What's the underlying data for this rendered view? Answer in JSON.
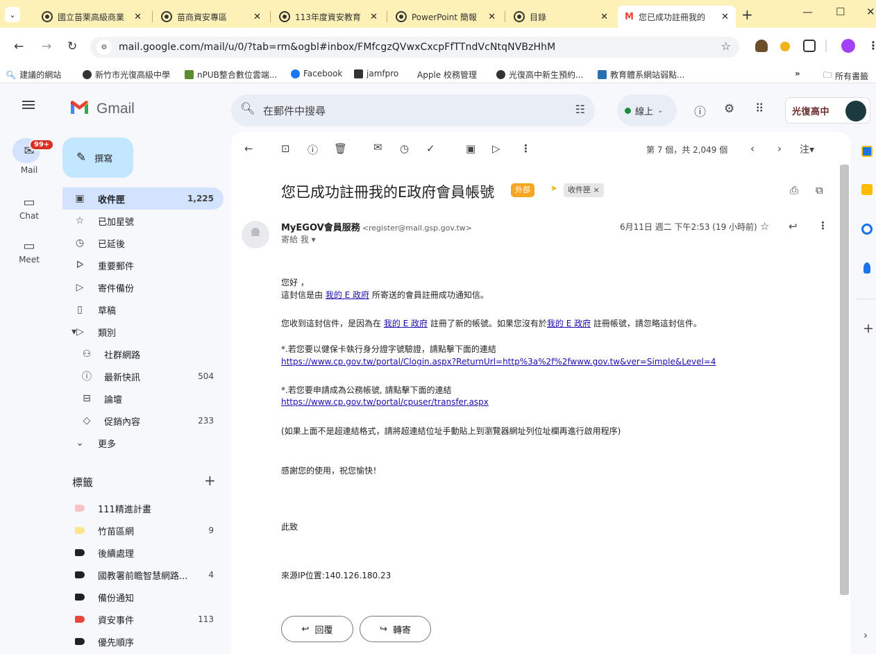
{
  "browser": {
    "tabs": [
      {
        "title": "國立苗栗高級商業"
      },
      {
        "title": "苗商資安專區"
      },
      {
        "title": "113年度資安教育"
      },
      {
        "title": "PowerPoint 簡報"
      },
      {
        "title": "目錄"
      },
      {
        "title": "您已成功註冊我的"
      }
    ],
    "url": "mail.google.com/mail/u/0/?tab=rm&ogbl#inbox/FMfcgzQVwxCxcpFfTTndVcNtqNVBzHhM",
    "bookmarks": [
      "建議的網站",
      "新竹市光復高級中學",
      "nPUB整合數位雲端...",
      "Facebook",
      "jamfpro",
      "Apple 校務管理",
      "光復高中新生預約...",
      "教育體系網站弱點..."
    ],
    "bookmarks_overflow": "»",
    "all_bookmarks": "所有書籤"
  },
  "header": {
    "app_name": "Gmail",
    "search_placeholder": "在郵件中搜尋",
    "status": "線上",
    "org_badge": "光復高中"
  },
  "rail": {
    "mail_badge": "99+",
    "mail": "Mail",
    "chat": "Chat",
    "meet": "Meet"
  },
  "sidebar": {
    "compose": "撰寫",
    "items": [
      {
        "label": "收件匣",
        "count": "1,225",
        "icon": "inbox-icon"
      },
      {
        "label": "已加星號",
        "count": "",
        "icon": "star-icon"
      },
      {
        "label": "已延後",
        "count": "",
        "icon": "clock-icon"
      },
      {
        "label": "重要郵件",
        "count": "",
        "icon": "important-icon"
      },
      {
        "label": "寄件備份",
        "count": "",
        "icon": "send-icon"
      },
      {
        "label": "草稿",
        "count": "",
        "icon": "draft-icon"
      },
      {
        "label": "類別",
        "count": "",
        "icon": "category-icon"
      },
      {
        "label": "社群網路",
        "count": "",
        "icon": "social-icon"
      },
      {
        "label": "最新快訊",
        "count": "504",
        "icon": "info-icon"
      },
      {
        "label": "論壇",
        "count": "",
        "icon": "forum-icon"
      },
      {
        "label": "促銷內容",
        "count": "233",
        "icon": "tag-icon"
      },
      {
        "label": "更多",
        "count": "",
        "icon": "chevron-down-icon"
      }
    ],
    "labels_heading": "標籤",
    "labels": [
      {
        "label": "111精進計畫",
        "count": "",
        "color": "#f7c3c3"
      },
      {
        "label": "竹苗區網",
        "count": "9",
        "color": "#fde68a"
      },
      {
        "label": "後續處理",
        "count": "",
        "color": "#202124"
      },
      {
        "label": "國教署前瞻智慧網路...",
        "count": "4",
        "color": "#202124"
      },
      {
        "label": "備份通知",
        "count": "",
        "color": "#202124"
      },
      {
        "label": "資安事件",
        "count": "113",
        "color": "#e8453c"
      },
      {
        "label": "優先順序",
        "count": "",
        "color": "#202124"
      }
    ]
  },
  "message": {
    "page_count": "第 7 個，共 2,049 個",
    "subject": "您已成功註冊我的E政府會員帳號",
    "external_chip": "外部",
    "inbox_chip": "收件匣 ×",
    "sender_name": "MyEGOV會員服務",
    "sender_email": "<register@mail.gsp.gov.tw>",
    "to": "寄給 我 ▾",
    "date": "6月11日 週二 下午2:53 (19 小時前)",
    "body": {
      "greeting": "您好 ，",
      "l1_pre": "這封信是由 ",
      "l1_link": "我的 E 政府",
      "l1_post": " 所寄送的會員註冊成功通知信。",
      "l2_pre": "您收到這封信件，是因為在 ",
      "l2_link1": "我的 E 政府",
      "l2_mid": " 註冊了新的帳號。如果您沒有於",
      "l2_link2": "我的 E 政府",
      "l2_post": " 註冊帳號，請忽略這封信件。",
      "l3": "*.若您要以健保卡執行身分證字號驗證，請點擊下面的連結",
      "l3_link": "https://www.cp.gov.tw/portal/Clogin.aspx?ReturnUrl=http%3a%2f%2fwww.gov.tw&ver=Simple&Level=4",
      "l4": "*.若您要申請成為公務帳號, 請點擊下面的連結",
      "l4_link": "https://www.cp.gov.tw/portal/cpuser/transfer.aspx",
      "l5": "(如果上面不是超連結格式，請將超連結位址手動貼上到瀏覽器網址列位址欄再進行啟用程序)",
      "l6": "感謝您的使用，祝您愉快！",
      "l7": "此致",
      "l8": "來源IP位置:140.126.180.23"
    },
    "reply": "回覆",
    "forward": "轉寄"
  }
}
